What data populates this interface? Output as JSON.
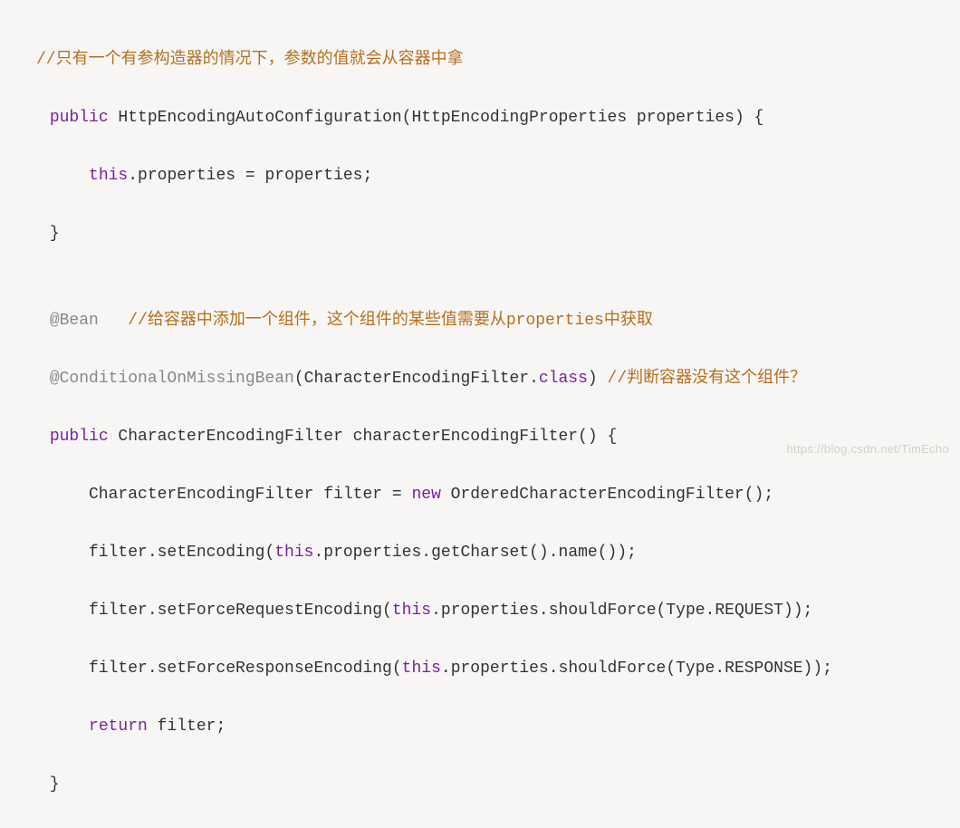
{
  "code": {
    "l1_comment": "//只有一个有参构造器的情况下，参数的值就会从容器中拿",
    "l2_pre": " ",
    "l2_kw": "public",
    "l2_rest": " HttpEncodingAutoConfiguration(HttpEncodingProperties properties) {",
    "l3_pre": "     ",
    "l3_kw": "this",
    "l3_rest": ".properties = properties;",
    "l4": " }",
    "l5": "",
    "l6_pre": " ",
    "l6_anno": "@Bean",
    "l6_sp": "   ",
    "l6_comment": "//给容器中添加一个组件，这个组件的某些值需要从properties中获取",
    "l7_pre": " ",
    "l7_anno": "@ConditionalOnMissingBean",
    "l7_mid1": "(CharacterEncodingFilter.",
    "l7_kw": "class",
    "l7_mid2": ") ",
    "l7_comment": "//判断容器没有这个组件？",
    "l8_pre": " ",
    "l8_kw": "public",
    "l8_rest": " CharacterEncodingFilter characterEncodingFilter() {",
    "l9_pre": "     CharacterEncodingFilter filter = ",
    "l9_kw": "new",
    "l9_rest": " OrderedCharacterEncodingFilter();",
    "l10_pre": "     filter.setEncoding(",
    "l10_kw": "this",
    "l10_rest": ".properties.getCharset().name());",
    "l11_pre": "     filter.setForceRequestEncoding(",
    "l11_kw": "this",
    "l11_rest": ".properties.shouldForce(Type.REQUEST));",
    "l12_pre": "     filter.setForceResponseEncoding(",
    "l12_kw": "this",
    "l12_rest": ".properties.shouldForce(Type.RESPONSE));",
    "l13_pre": "     ",
    "l13_kw": "return",
    "l13_rest": " filter;",
    "l14": " }"
  },
  "watermark": "https://blog.csdn.net/TimEcho"
}
